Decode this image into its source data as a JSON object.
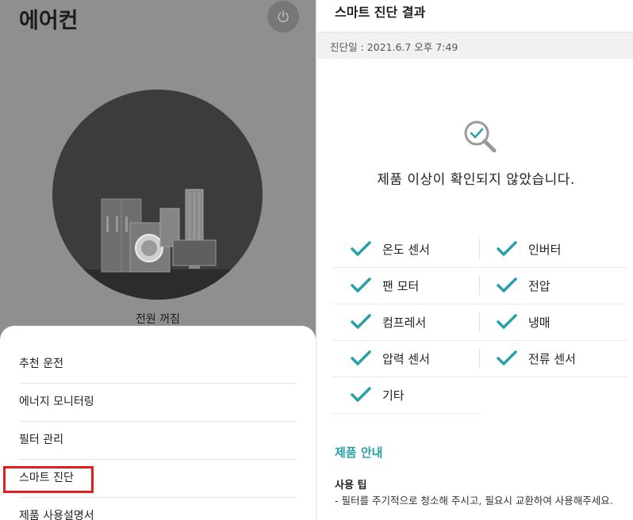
{
  "left": {
    "title": "에어컨",
    "power_status": "전원 꺼짐",
    "menu": [
      {
        "label": "추천 운전"
      },
      {
        "label": "에너지 모니터링"
      },
      {
        "label": "필터 관리"
      },
      {
        "label": "스마트 진단"
      },
      {
        "label": "제품 사용설명서"
      }
    ],
    "highlighted_item": "스마트 진단",
    "highlight_color": "#e11d1d"
  },
  "right": {
    "header": "스마트 진단 결과",
    "date": "진단일 : 2021.6.7 오후 7:49",
    "result": "제품 이상이 확인되지 않았습니다.",
    "checks": [
      [
        "온도 센서",
        "인버터"
      ],
      [
        "팬 모터",
        "전압"
      ],
      [
        "컴프레서",
        "냉매"
      ],
      [
        "압력 센서",
        "전류 센서"
      ],
      [
        "기타"
      ]
    ],
    "section_title": "제품 안내",
    "tip_title": "사용 팁",
    "tip_text": "- 필터를 주기적으로 청소해 주시고, 필요시 교환하여 사용해주세요.",
    "accent_color": "#2aa0a8",
    "icons": {
      "power": "power-icon",
      "diagnosis": "magnifier-check-icon",
      "check": "checkmark-icon"
    }
  }
}
